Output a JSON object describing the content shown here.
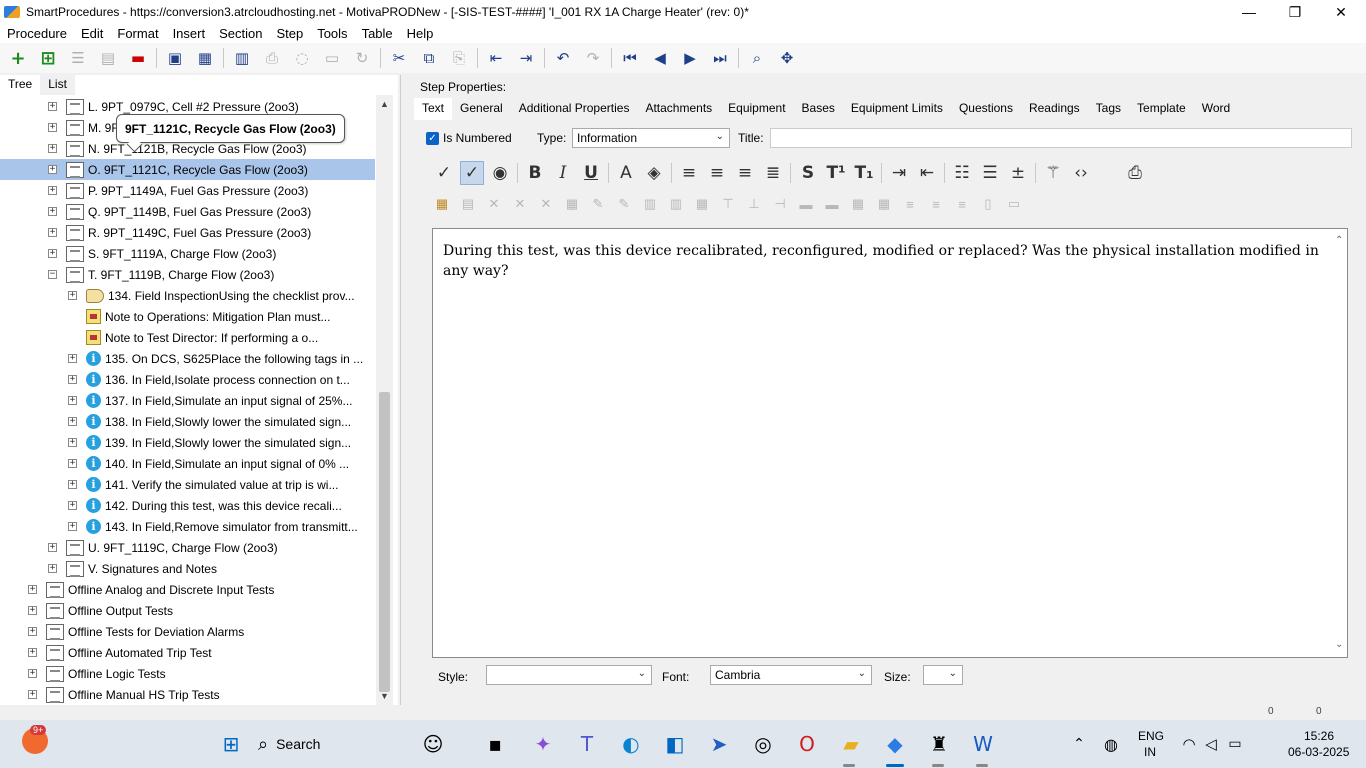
{
  "window": {
    "title": "SmartProcedures - https://conversion3.atrcloudhosting.net - MotivaPRODNew - [-SIS-TEST-####] 'I_001 RX 1A Charge Heater' (rev: 0)*",
    "minimize": "—",
    "maximize": "❐",
    "close": "✕"
  },
  "menu": [
    "Procedure",
    "Edit",
    "Format",
    "Insert",
    "Section",
    "Step",
    "Tools",
    "Table",
    "Help"
  ],
  "left_tabs": [
    "Tree",
    "List"
  ],
  "tree": {
    "tooltip": "9FT_1121C, Recycle Gas Flow (2oo3)",
    "rows": [
      {
        "label": "L. 9PT_0979C, Cell #2 Pressure (2oo3)",
        "icon": "doc-icon"
      },
      {
        "label": "M. 9F",
        "icon": "doc-icon"
      },
      {
        "label": "N. 9FT_1121B, Recycle Gas Flow (2oo3)",
        "icon": "doc-icon"
      },
      {
        "label": "O. 9FT_1121C, Recycle Gas Flow (2oo3)",
        "icon": "doc-icon",
        "selected": true
      },
      {
        "label": "P. 9PT_1149A, Fuel Gas Pressure (2oo3)",
        "icon": "doc-icon"
      },
      {
        "label": "Q. 9PT_1149B, Fuel Gas Pressure (2oo3)",
        "icon": "doc-icon"
      },
      {
        "label": "R. 9PT_1149C, Fuel Gas Pressure (2oo3)",
        "icon": "doc-icon"
      },
      {
        "label": "S. 9FT_1119A, Charge Flow (2oo3)",
        "icon": "doc-icon"
      },
      {
        "label": "T. 9FT_1119B, Charge Flow (2oo3)",
        "icon": "doc-icon",
        "expanded": true
      },
      {
        "label": "134. Field InspectionUsing the checklist prov...",
        "icon": "hand-icon"
      },
      {
        "label": "Note to Operations: Mitigation Plan must...",
        "icon": "note-icon"
      },
      {
        "label": "Note to Test Director: If performing a o...",
        "icon": "note-icon"
      },
      {
        "label": "135. On DCS, S625Place the following tags in ...",
        "icon": "info-icon"
      },
      {
        "label": "136. In Field,Isolate process connection on t...",
        "icon": "info-icon"
      },
      {
        "label": "137. In Field,Simulate an input signal of 25%...",
        "icon": "info-icon"
      },
      {
        "label": "138. In Field,Slowly lower the simulated sign...",
        "icon": "info-icon"
      },
      {
        "label": "139. In Field,Slowly lower the simulated sign...",
        "icon": "info-icon"
      },
      {
        "label": "140. In Field,Simulate an input signal of 0% ...",
        "icon": "info-icon"
      },
      {
        "label": "141. Verify the simulated value at trip is wi...",
        "icon": "info-icon"
      },
      {
        "label": "142. During this test, was this device recali...",
        "icon": "info-icon"
      },
      {
        "label": "143. In Field,Remove simulator from transmitt...",
        "icon": "info-icon"
      },
      {
        "label": "U. 9FT_1119C, Charge Flow (2oo3)",
        "icon": "doc-icon"
      },
      {
        "label": "V. Signatures and Notes",
        "icon": "doc-icon"
      },
      {
        "label": "Offline Analog and Discrete Input Tests",
        "icon": "doc-icon"
      },
      {
        "label": "Offline Output Tests",
        "icon": "doc-icon"
      },
      {
        "label": "Offline Tests for Deviation Alarms",
        "icon": "doc-icon"
      },
      {
        "label": "Offline Automated Trip Test",
        "icon": "doc-icon"
      },
      {
        "label": "Offline Logic Tests",
        "icon": "doc-icon"
      },
      {
        "label": "Offline Manual HS Trip Tests",
        "icon": "doc-icon"
      }
    ]
  },
  "step_properties": {
    "label": "Step Properties:",
    "tabs": [
      "Text",
      "General",
      "Additional Properties",
      "Attachments",
      "Equipment",
      "Bases",
      "Equipment Limits",
      "Questions",
      "Readings",
      "Tags",
      "Template",
      "Word"
    ],
    "is_numbered_label": "Is Numbered",
    "is_numbered": true,
    "type_label": "Type:",
    "type_value": "Information",
    "title_label": "Title:",
    "title_value": "",
    "body_text": "During this test, was this device recalibrated, reconfigured, modified or replaced?  Was the physical installation modified in any way?",
    "style_label": "Style:",
    "style_value": "",
    "font_label": "Font:",
    "font_value": "Cambria",
    "size_label": "Size:",
    "size_value": ""
  },
  "hscroll": {
    "a": "0",
    "b": "0"
  },
  "taskbar": {
    "badge": "9+",
    "search_label": "Search",
    "lang": "ENG",
    "region": "IN",
    "time": "15:26",
    "date": "06-03-2025"
  },
  "colors": {
    "selection": "#a9c5ea",
    "accent": "#0a64c8",
    "taskbar": "#dfe6ee"
  }
}
